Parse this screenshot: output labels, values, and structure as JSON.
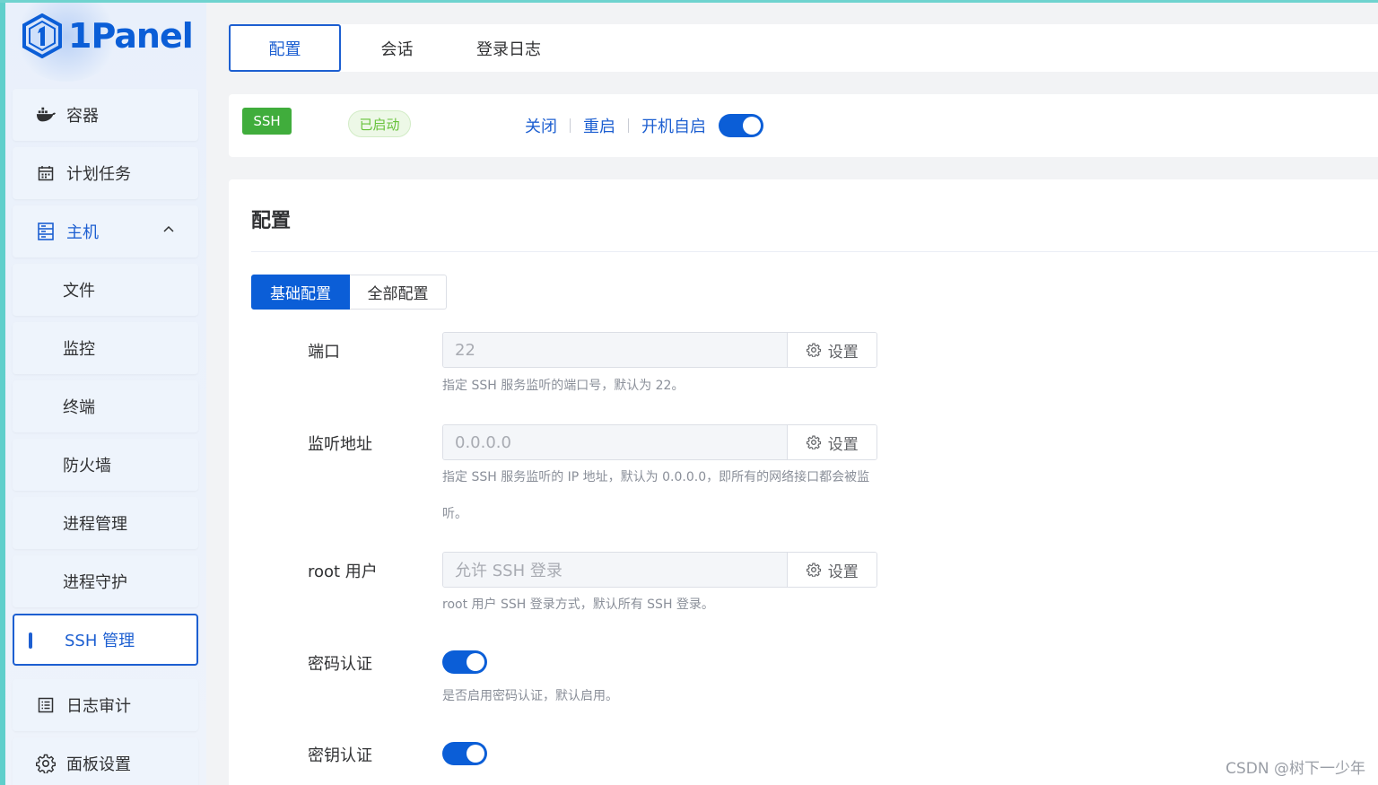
{
  "app": {
    "logo_text": "1Panel",
    "watermark": "CSDN @树下一少年"
  },
  "sidebar": {
    "items": [
      {
        "label": "容器",
        "icon": "docker-icon"
      },
      {
        "label": "计划任务",
        "icon": "calendar-icon"
      },
      {
        "label": "主机",
        "icon": "server-icon",
        "expanded": true
      },
      {
        "label": "文件"
      },
      {
        "label": "监控"
      },
      {
        "label": "终端"
      },
      {
        "label": "防火墙"
      },
      {
        "label": "进程管理"
      },
      {
        "label": "进程守护"
      },
      {
        "label": "SSH 管理",
        "active": true
      },
      {
        "label": "日志审计",
        "icon": "log-icon"
      },
      {
        "label": "面板设置",
        "icon": "gear-icon"
      }
    ]
  },
  "tabs": [
    {
      "label": "配置",
      "active": true
    },
    {
      "label": "会话"
    },
    {
      "label": "登录日志"
    }
  ],
  "status": {
    "service_tag": "SSH",
    "state": "已启动",
    "actions": [
      "关闭",
      "重启",
      "开机自启"
    ],
    "autostart_enabled": true
  },
  "config": {
    "title": "配置",
    "segments": [
      "基础配置",
      "全部配置"
    ],
    "set_label": "设置",
    "fields": [
      {
        "label": "端口",
        "value": "22",
        "hint": "指定 SSH 服务监听的端口号，默认为 22。"
      },
      {
        "label": "监听地址",
        "value": "0.0.0.0",
        "hint": "指定 SSH 服务监听的 IP 地址，默认为 0.0.0.0，即所有的网络接口都会被监听。"
      },
      {
        "label": "root 用户",
        "value": "允许 SSH 登录",
        "hint": "root 用户 SSH 登录方式，默认所有 SSH 登录。"
      },
      {
        "label": "密码认证",
        "enabled": true,
        "hint": "是否启用密码认证，默认启用。"
      },
      {
        "label": "密钥认证",
        "enabled": true
      }
    ]
  },
  "colors": {
    "primary": "#0b5ed7",
    "success": "#40ad3c"
  }
}
